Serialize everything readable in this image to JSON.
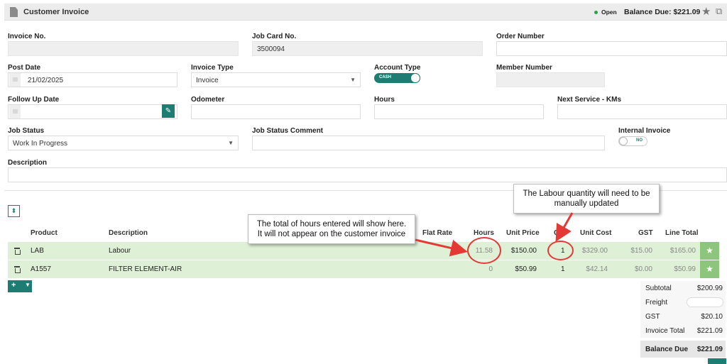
{
  "header": {
    "title": "Customer Invoice",
    "status": "Open",
    "balance_due": "Balance Due: $221.09",
    "status_color": "#2aa24a"
  },
  "form": {
    "invoice_no": {
      "label": "Invoice No.",
      "value": ""
    },
    "job_card_no": {
      "label": "Job Card No.",
      "value": "3500094"
    },
    "order_number": {
      "label": "Order Number",
      "value": ""
    },
    "post_date": {
      "label": "Post Date",
      "value": "21/02/2025"
    },
    "invoice_type": {
      "label": "Invoice Type",
      "value": "Invoice"
    },
    "account_type": {
      "label": "Account Type",
      "toggle_label": "CASH"
    },
    "member_number": {
      "label": "Member Number",
      "value": ""
    },
    "follow_up_date": {
      "label": "Follow Up Date",
      "value": ""
    },
    "odometer": {
      "label": "Odometer",
      "value": ""
    },
    "hours": {
      "label": "Hours",
      "value": ""
    },
    "next_service": {
      "label": "Next Service - KMs",
      "value": ""
    },
    "job_status": {
      "label": "Job Status",
      "value": "Work In Progress"
    },
    "job_status_comment": {
      "label": "Job Status Comment",
      "value": ""
    },
    "internal_invoice": {
      "label": "Internal Invoice",
      "toggle_label": "NO"
    },
    "description": {
      "label": "Description",
      "value": ""
    }
  },
  "table": {
    "headers": {
      "product": "Product",
      "description": "Description",
      "flat_rate": "Flat Rate",
      "hours": "Hours",
      "unit_price": "Unit Price",
      "qty": "Qty",
      "unit_cost": "Unit Cost",
      "gst": "GST",
      "line_total": "Line Total"
    },
    "rows": [
      {
        "product": "LAB",
        "description": "Labour",
        "hours": "11.58",
        "unit_price": "$150.00",
        "qty": "1",
        "unit_cost": "$329.00",
        "gst": "$15.00",
        "line_total": "$165.00"
      },
      {
        "product": "A1557",
        "description": "FILTER ELEMENT-AIR",
        "hours": "0",
        "unit_price": "$50.99",
        "qty": "1",
        "unit_cost": "$42.14",
        "gst": "$0.00",
        "line_total": "$50.99"
      }
    ]
  },
  "totals": {
    "subtotal": {
      "label": "Subtotal",
      "value": "$200.99"
    },
    "freight": {
      "label": "Freight",
      "value": ""
    },
    "gst": {
      "label": "GST",
      "value": "$20.10"
    },
    "invoice_total": {
      "label": "Invoice Total",
      "value": "$221.09"
    },
    "balance_due": {
      "label": "Balance Due",
      "value": "$221.09"
    }
  },
  "annotations": {
    "hours_note": "The total of hours entered will show here. It will not appear on the customer invoice",
    "qty_note": "The Labour quantity will need to be manually updated"
  },
  "colors": {
    "accent": "#1d7d73",
    "row_bg": "#def0d6",
    "favourite_bg": "#8cc57b",
    "annotation_red": "#e53935"
  }
}
